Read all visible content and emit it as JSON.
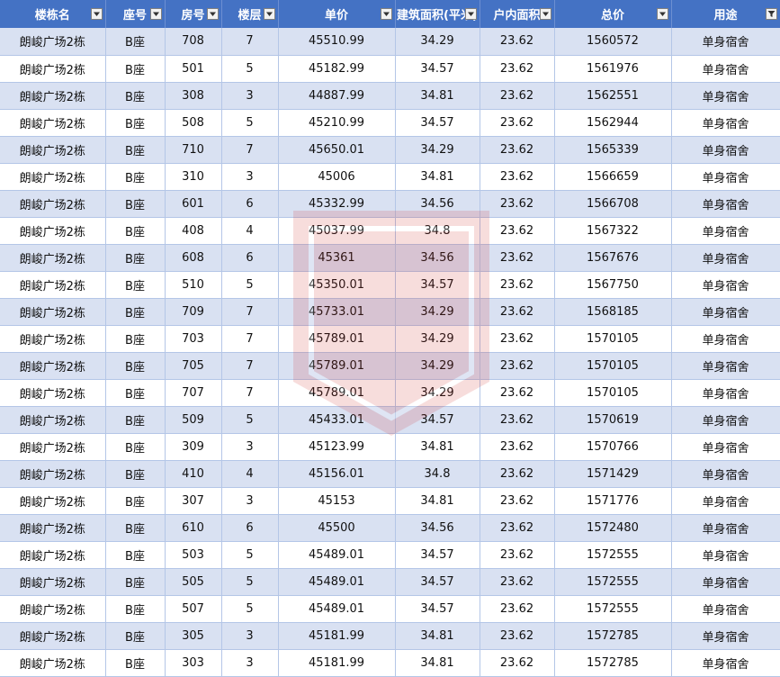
{
  "colors": {
    "header_bg": "#4472c4",
    "band_row": "#d9e1f2",
    "plain_row": "#ffffff",
    "watermark": "#d0302f"
  },
  "headers": [
    {
      "label": "楼栋名",
      "filter": "filter-dropdown-icon"
    },
    {
      "label": "座号",
      "filter": "filter-dropdown-icon"
    },
    {
      "label": "房号",
      "filter": "filter-dropdown-icon"
    },
    {
      "label": "楼层",
      "filter": "filter-dropdown-icon"
    },
    {
      "label": "单价",
      "filter": "filter-dropdown-icon"
    },
    {
      "label": "建筑面积(平米)",
      "filter": "filter-dropdown-icon"
    },
    {
      "label": "户内面积",
      "filter": "filter-dropdown-icon"
    },
    {
      "label": "总价",
      "filter": "filter-dropdown-icon"
    },
    {
      "label": "用途",
      "filter": "filter-applied-icon"
    }
  ],
  "rows": [
    [
      "朗峻广场2栋",
      "B座",
      "708",
      "7",
      "45510.99",
      "34.29",
      "23.62",
      "1560572",
      "单身宿舍"
    ],
    [
      "朗峻广场2栋",
      "B座",
      "501",
      "5",
      "45182.99",
      "34.57",
      "23.62",
      "1561976",
      "单身宿舍"
    ],
    [
      "朗峻广场2栋",
      "B座",
      "308",
      "3",
      "44887.99",
      "34.81",
      "23.62",
      "1562551",
      "单身宿舍"
    ],
    [
      "朗峻广场2栋",
      "B座",
      "508",
      "5",
      "45210.99",
      "34.57",
      "23.62",
      "1562944",
      "单身宿舍"
    ],
    [
      "朗峻广场2栋",
      "B座",
      "710",
      "7",
      "45650.01",
      "34.29",
      "23.62",
      "1565339",
      "单身宿舍"
    ],
    [
      "朗峻广场2栋",
      "B座",
      "310",
      "3",
      "45006",
      "34.81",
      "23.62",
      "1566659",
      "单身宿舍"
    ],
    [
      "朗峻广场2栋",
      "B座",
      "601",
      "6",
      "45332.99",
      "34.56",
      "23.62",
      "1566708",
      "单身宿舍"
    ],
    [
      "朗峻广场2栋",
      "B座",
      "408",
      "4",
      "45037.99",
      "34.8",
      "23.62",
      "1567322",
      "单身宿舍"
    ],
    [
      "朗峻广场2栋",
      "B座",
      "608",
      "6",
      "45361",
      "34.56",
      "23.62",
      "1567676",
      "单身宿舍"
    ],
    [
      "朗峻广场2栋",
      "B座",
      "510",
      "5",
      "45350.01",
      "34.57",
      "23.62",
      "1567750",
      "单身宿舍"
    ],
    [
      "朗峻广场2栋",
      "B座",
      "709",
      "7",
      "45733.01",
      "34.29",
      "23.62",
      "1568185",
      "单身宿舍"
    ],
    [
      "朗峻广场2栋",
      "B座",
      "703",
      "7",
      "45789.01",
      "34.29",
      "23.62",
      "1570105",
      "单身宿舍"
    ],
    [
      "朗峻广场2栋",
      "B座",
      "705",
      "7",
      "45789.01",
      "34.29",
      "23.62",
      "1570105",
      "单身宿舍"
    ],
    [
      "朗峻广场2栋",
      "B座",
      "707",
      "7",
      "45789.01",
      "34.29",
      "23.62",
      "1570105",
      "单身宿舍"
    ],
    [
      "朗峻广场2栋",
      "B座",
      "509",
      "5",
      "45433.01",
      "34.57",
      "23.62",
      "1570619",
      "单身宿舍"
    ],
    [
      "朗峻广场2栋",
      "B座",
      "309",
      "3",
      "45123.99",
      "34.81",
      "23.62",
      "1570766",
      "单身宿舍"
    ],
    [
      "朗峻广场2栋",
      "B座",
      "410",
      "4",
      "45156.01",
      "34.8",
      "23.62",
      "1571429",
      "单身宿舍"
    ],
    [
      "朗峻广场2栋",
      "B座",
      "307",
      "3",
      "45153",
      "34.81",
      "23.62",
      "1571776",
      "单身宿舍"
    ],
    [
      "朗峻广场2栋",
      "B座",
      "610",
      "6",
      "45500",
      "34.56",
      "23.62",
      "1572480",
      "单身宿舍"
    ],
    [
      "朗峻广场2栋",
      "B座",
      "503",
      "5",
      "45489.01",
      "34.57",
      "23.62",
      "1572555",
      "单身宿舍"
    ],
    [
      "朗峻广场2栋",
      "B座",
      "505",
      "5",
      "45489.01",
      "34.57",
      "23.62",
      "1572555",
      "单身宿舍"
    ],
    [
      "朗峻广场2栋",
      "B座",
      "507",
      "5",
      "45489.01",
      "34.57",
      "23.62",
      "1572555",
      "单身宿舍"
    ],
    [
      "朗峻广场2栋",
      "B座",
      "305",
      "3",
      "45181.99",
      "34.81",
      "23.62",
      "1572785",
      "单身宿舍"
    ],
    [
      "朗峻广场2栋",
      "B座",
      "303",
      "3",
      "45181.99",
      "34.81",
      "23.62",
      "1572785",
      "单身宿舍"
    ]
  ]
}
